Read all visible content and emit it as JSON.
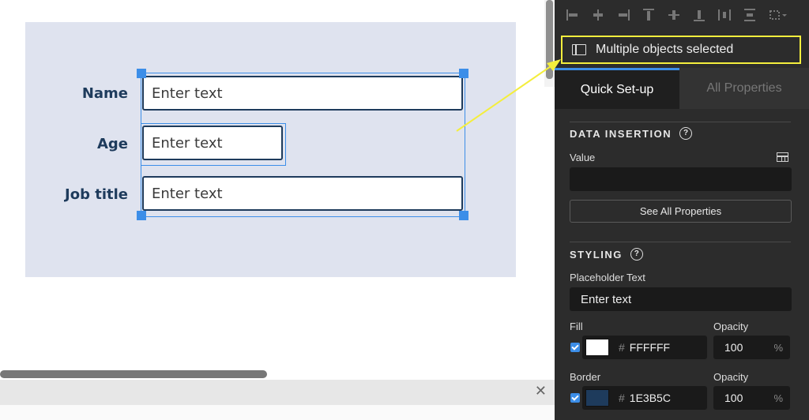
{
  "form": {
    "fields": [
      {
        "label": "Name",
        "placeholder": "Enter text"
      },
      {
        "label": "Age",
        "placeholder": "Enter text"
      },
      {
        "label": "Job title",
        "placeholder": "Enter text"
      }
    ]
  },
  "panel": {
    "selection_text": "Multiple objects selected",
    "tabs": {
      "quick": "Quick Set-up",
      "all": "All Properties"
    },
    "data_insertion": {
      "title": "DATA INSERTION",
      "value_label": "Value",
      "value": "",
      "see_all_label": "See All Properties"
    },
    "styling": {
      "title": "STYLING",
      "placeholder_label": "Placeholder Text",
      "placeholder_value": "Enter text",
      "fill_label": "Fill",
      "fill_hex": "FFFFFF",
      "fill_color": "#FFFFFF",
      "fill_opacity_label": "Opacity",
      "fill_opacity": "100",
      "border_label": "Border",
      "border_hex": "1E3B5C",
      "border_color": "#1E3B5C",
      "border_opacity_label": "Opacity",
      "border_opacity": "100",
      "percent": "%",
      "hash": "#"
    }
  },
  "colors": {
    "accent": "#3C8EE8",
    "highlight": "#F4EE3D",
    "label_text": "#1E3B5C"
  }
}
